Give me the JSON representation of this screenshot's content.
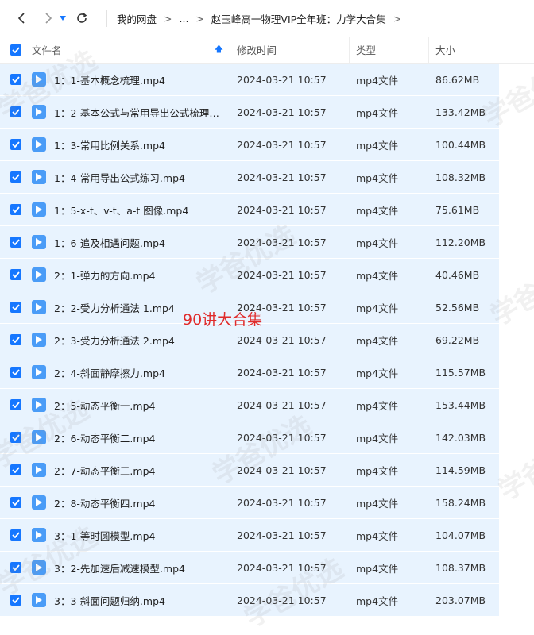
{
  "breadcrumb": {
    "items": [
      "我的网盘",
      "...",
      "赵玉峰高一物理VIP全年班：力学大合集"
    ],
    "sep": ">"
  },
  "columns": {
    "name": "文件名",
    "date": "修改时间",
    "type": "类型",
    "size": "大小"
  },
  "overlay": "90讲大合集",
  "watermark": "学爸优选",
  "files": [
    {
      "name": "1：1-基本概念梳理.mp4",
      "date": "2024-03-21 10:57",
      "type": "mp4文件",
      "size": "86.62MB"
    },
    {
      "name": "1：2-基本公式与常用导出公式梳理....",
      "date": "2024-03-21 10:57",
      "type": "mp4文件",
      "size": "133.42MB"
    },
    {
      "name": "1：3-常用比例关系.mp4",
      "date": "2024-03-21 10:57",
      "type": "mp4文件",
      "size": "100.44MB"
    },
    {
      "name": "1：4-常用导出公式练习.mp4",
      "date": "2024-03-21 10:57",
      "type": "mp4文件",
      "size": "108.32MB"
    },
    {
      "name": "1：5-x-t、v-t、a-t 图像.mp4",
      "date": "2024-03-21 10:57",
      "type": "mp4文件",
      "size": "75.61MB"
    },
    {
      "name": "1：6-追及相遇问题.mp4",
      "date": "2024-03-21 10:57",
      "type": "mp4文件",
      "size": "112.20MB"
    },
    {
      "name": "2：1-弹力的方向.mp4",
      "date": "2024-03-21 10:57",
      "type": "mp4文件",
      "size": "40.46MB"
    },
    {
      "name": "2：2-受力分析通法 1.mp4",
      "date": "2024-03-21 10:57",
      "type": "mp4文件",
      "size": "52.56MB"
    },
    {
      "name": "2：3-受力分析通法 2.mp4",
      "date": "2024-03-21 10:57",
      "type": "mp4文件",
      "size": "69.22MB"
    },
    {
      "name": "2：4-斜面静摩擦力.mp4",
      "date": "2024-03-21 10:57",
      "type": "mp4文件",
      "size": "115.57MB"
    },
    {
      "name": "2：5-动态平衡一.mp4",
      "date": "2024-03-21 10:57",
      "type": "mp4文件",
      "size": "153.44MB"
    },
    {
      "name": "2：6-动态平衡二.mp4",
      "date": "2024-03-21 10:57",
      "type": "mp4文件",
      "size": "142.03MB"
    },
    {
      "name": "2：7-动态平衡三.mp4",
      "date": "2024-03-21 10:57",
      "type": "mp4文件",
      "size": "114.59MB"
    },
    {
      "name": "2：8-动态平衡四.mp4",
      "date": "2024-03-21 10:57",
      "type": "mp4文件",
      "size": "158.24MB"
    },
    {
      "name": "3：1-等时圆模型.mp4",
      "date": "2024-03-21 10:57",
      "type": "mp4文件",
      "size": "104.07MB"
    },
    {
      "name": "3：2-先加速后减速模型.mp4",
      "date": "2024-03-21 10:57",
      "type": "mp4文件",
      "size": "108.37MB"
    },
    {
      "name": "3：3-斜面问题归纳.mp4",
      "date": "2024-03-21 10:57",
      "type": "mp4文件",
      "size": "203.07MB"
    }
  ]
}
